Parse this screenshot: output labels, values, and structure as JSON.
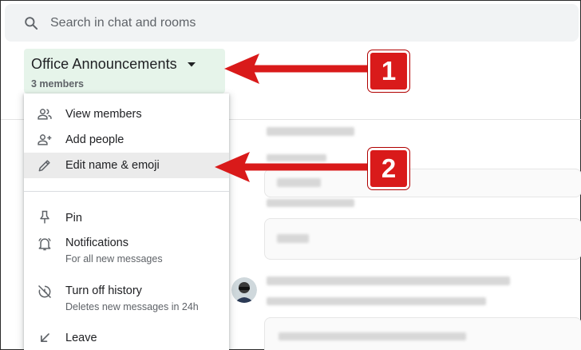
{
  "search": {
    "placeholder": "Search in chat and rooms",
    "icon": "search-icon"
  },
  "room": {
    "title": "Office Announcements",
    "members": "3 members",
    "background_color": "#e6f4ea"
  },
  "menu": {
    "items": [
      {
        "label": "View members",
        "icon": "people-icon"
      },
      {
        "label": "Add people",
        "icon": "person-add-icon"
      },
      {
        "label": "Edit name & emoji",
        "icon": "pencil-icon",
        "highlighted": true
      },
      {
        "label": "Pin",
        "icon": "pin-icon"
      },
      {
        "label": "Notifications",
        "sub": "For all new messages",
        "icon": "bell-icon"
      },
      {
        "label": "Turn off history",
        "sub": "Deletes new messages in 24h",
        "icon": "history-off-icon"
      },
      {
        "label": "Leave",
        "icon": "leave-arrow-icon"
      }
    ]
  },
  "annotations": {
    "badge_1": "1",
    "badge_2": "2",
    "color": "#d91a1a"
  }
}
